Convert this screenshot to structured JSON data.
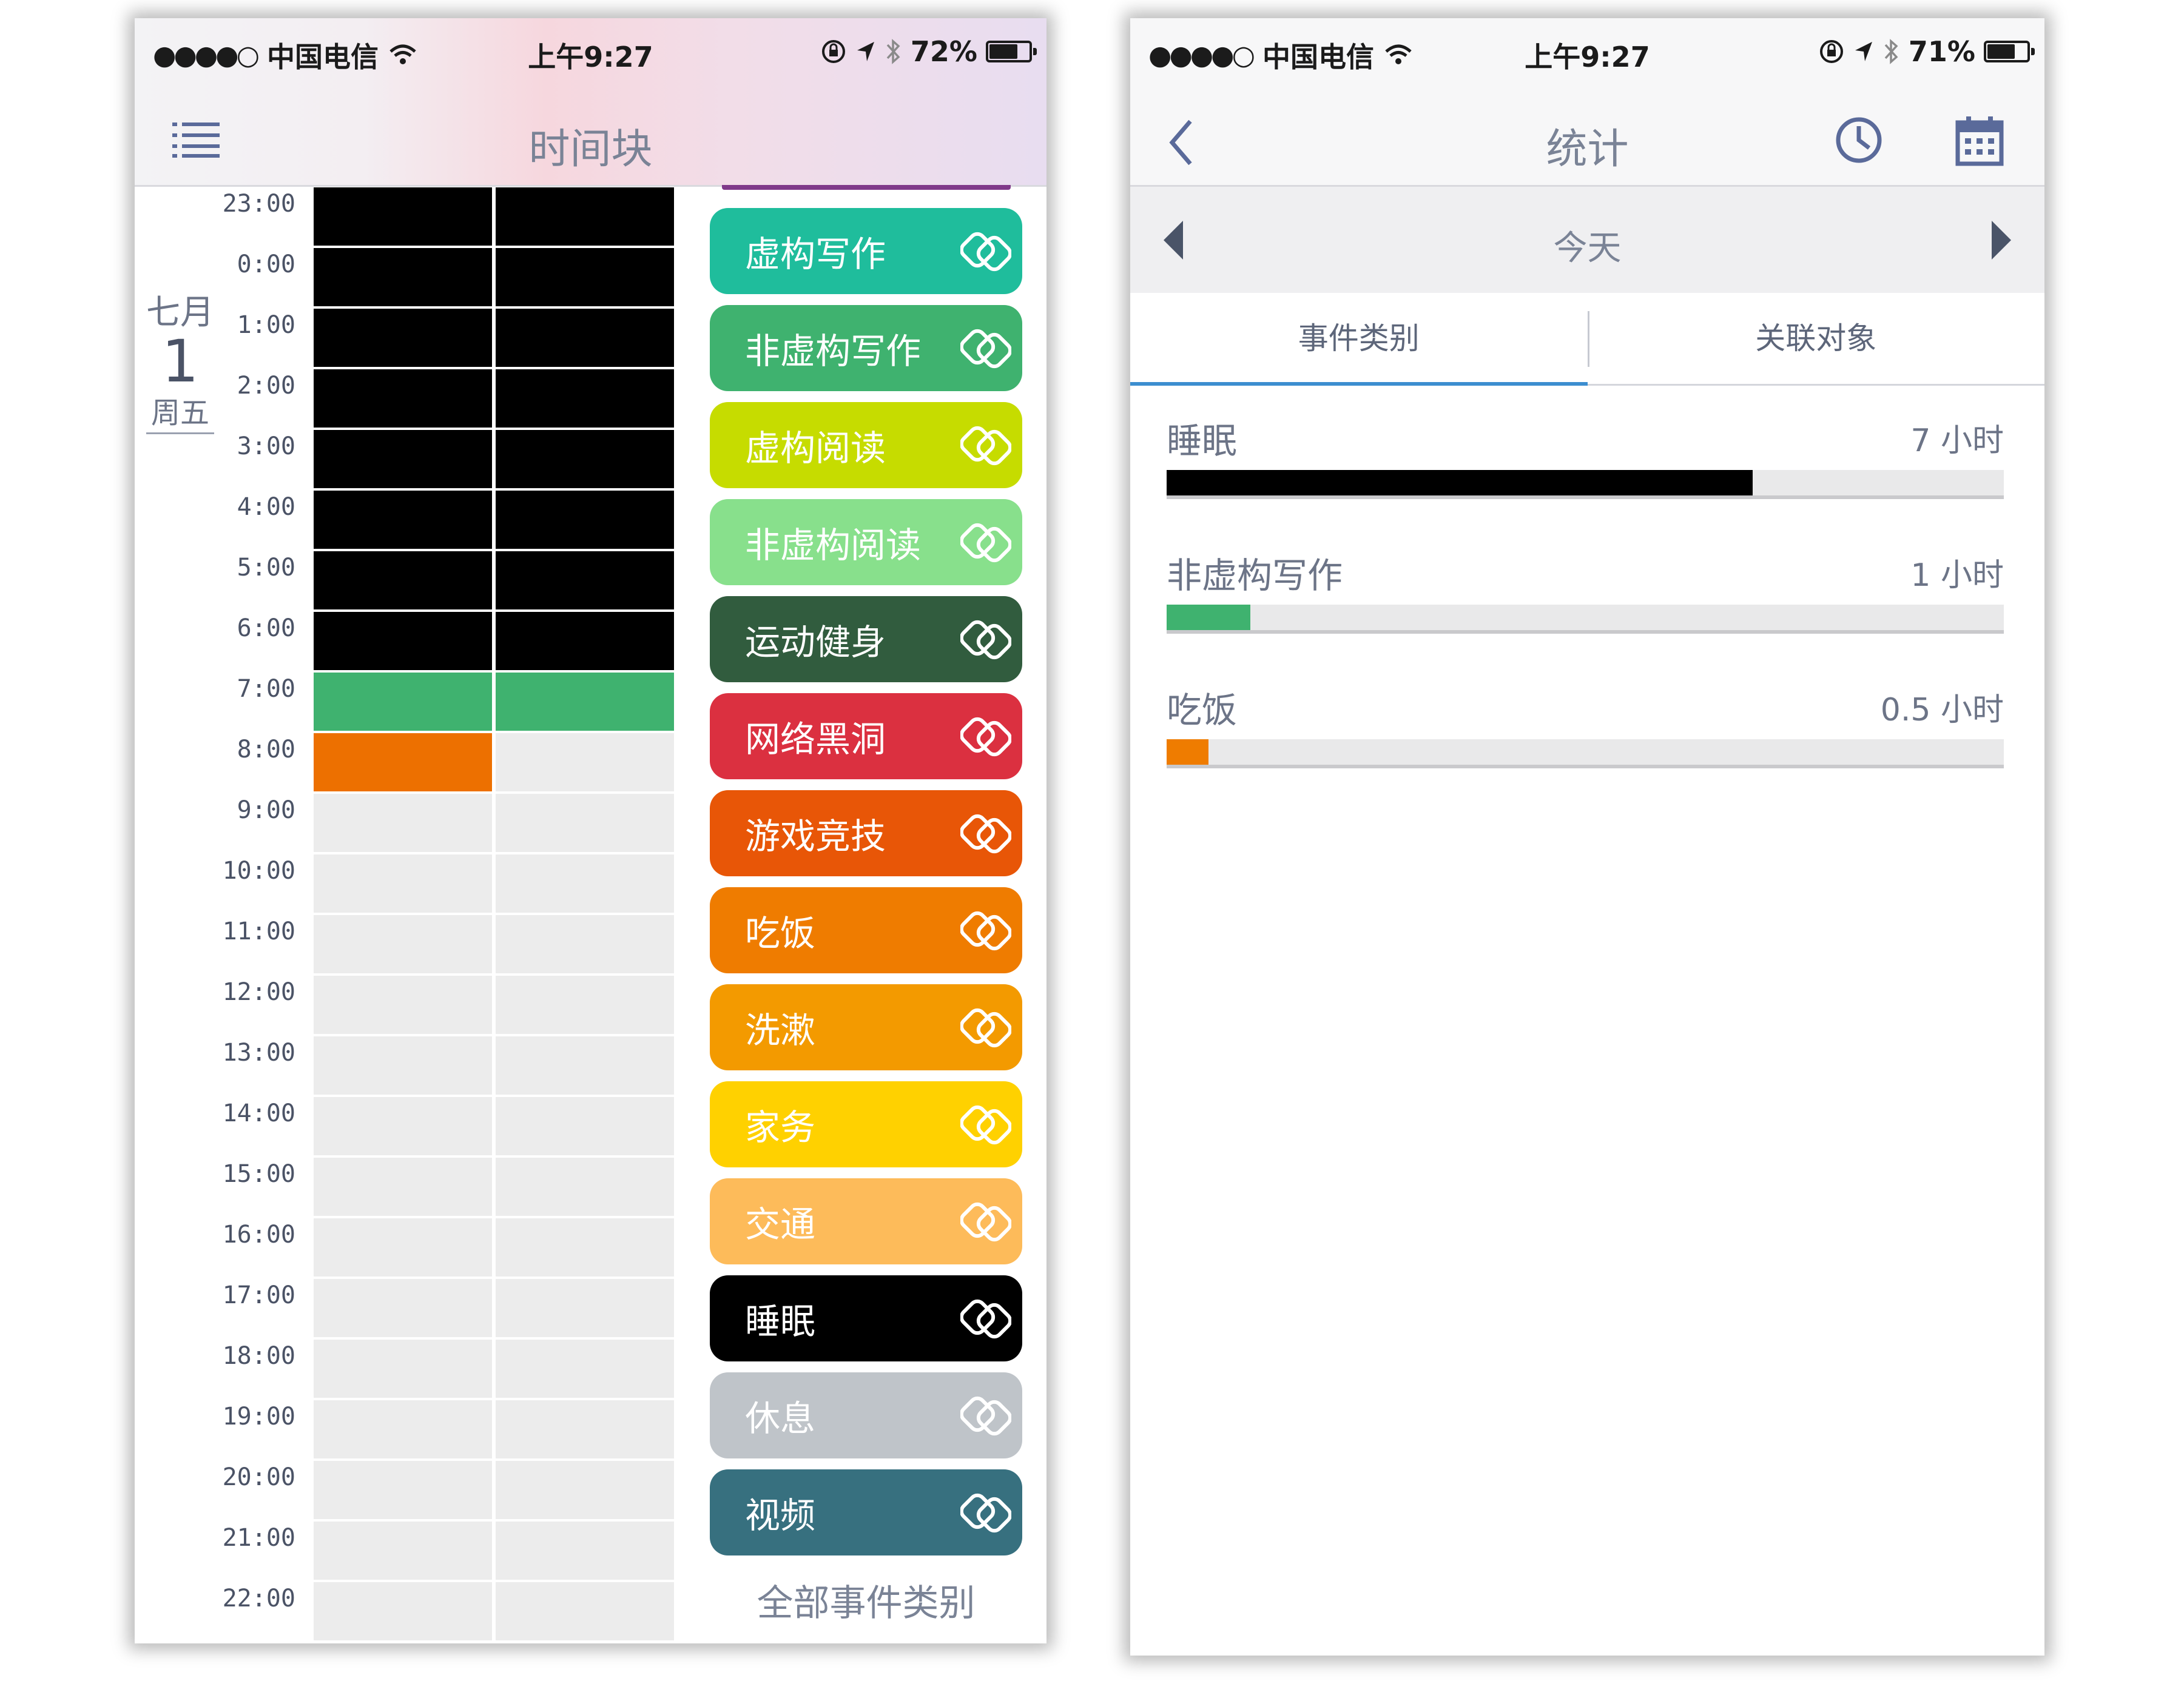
{
  "left_phone": {
    "status": {
      "carrier": "中国电信",
      "time": "上午9:27",
      "battery_text": "72%",
      "battery_level": 0.72
    },
    "nav": {
      "title": "时间块"
    },
    "date": {
      "month": "七月",
      "day": "1",
      "weekday": "周五"
    },
    "hours": [
      "23:00",
      "0:00",
      "1:00",
      "2:00",
      "3:00",
      "4:00",
      "5:00",
      "6:00",
      "7:00",
      "8:00",
      "9:00",
      "10:00",
      "11:00",
      "12:00",
      "13:00",
      "14:00",
      "15:00",
      "16:00",
      "17:00",
      "18:00",
      "19:00",
      "20:00",
      "21:00",
      "22:00"
    ],
    "grid": {
      "empty_color": "#ececec",
      "col1": [
        "#000000",
        "#000000",
        "#000000",
        "#000000",
        "#000000",
        "#000000",
        "#000000",
        "#000000",
        "#3fb26f",
        "#ed7000",
        "",
        "",
        "",
        "",
        "",
        "",
        "",
        "",
        "",
        "",
        "",
        "",
        "",
        ""
      ],
      "col2": [
        "#000000",
        "#000000",
        "#000000",
        "#000000",
        "#000000",
        "#000000",
        "#000000",
        "#000000",
        "#3fb26f",
        "",
        "",
        "",
        "",
        "",
        "",
        "",
        "",
        "",
        "",
        "",
        "",
        "",
        "",
        ""
      ]
    },
    "categories": [
      {
        "label": "虚构写作",
        "color": "#1fbd9c",
        "text_color": "#ffffff"
      },
      {
        "label": "非虚构写作",
        "color": "#3fb26f",
        "text_color": "#ffffff"
      },
      {
        "label": "虚构阅读",
        "color": "#c6dc00",
        "text_color": "#ffffff"
      },
      {
        "label": "非虚构阅读",
        "color": "#88e08c",
        "text_color": "#ffffff"
      },
      {
        "label": "运动健身",
        "color": "#315c3e",
        "text_color": "#ffffff"
      },
      {
        "label": "网络黑洞",
        "color": "#db3040",
        "text_color": "#ffffff"
      },
      {
        "label": "游戏竞技",
        "color": "#e85607",
        "text_color": "#ffffff"
      },
      {
        "label": "吃饭",
        "color": "#ef7c00",
        "text_color": "#ffffff"
      },
      {
        "label": "洗漱",
        "color": "#f39a00",
        "text_color": "#ffffff"
      },
      {
        "label": "家务",
        "color": "#ffd100",
        "text_color": "#ffffff"
      },
      {
        "label": "交通",
        "color": "#fdbb5a",
        "text_color": "#ffffff"
      },
      {
        "label": "睡眠",
        "color": "#000000",
        "text_color": "#ffffff"
      },
      {
        "label": "休息",
        "color": "#bfc4c9",
        "text_color": "#ffffff"
      },
      {
        "label": "视频",
        "color": "#37707f",
        "text_color": "#ffffff"
      }
    ],
    "all_categories_label": "全部事件类别"
  },
  "right_phone": {
    "status": {
      "carrier": "中国电信",
      "time": "上午9:27",
      "battery_text": "71%",
      "battery_level": 0.71
    },
    "nav": {
      "title": "统计"
    },
    "date_bar": {
      "label": "今天"
    },
    "tabs": [
      {
        "label": "事件类别",
        "active": true
      },
      {
        "label": "关联对象",
        "active": false
      }
    ],
    "stats": [
      {
        "label": "睡眠",
        "value": "7 小时",
        "fraction": 0.7,
        "color": "#000000"
      },
      {
        "label": "非虚构写作",
        "value": "1 小时",
        "fraction": 0.1,
        "color": "#3fb26f"
      },
      {
        "label": "吃饭",
        "value": "0.5 小时",
        "fraction": 0.05,
        "color": "#ef7c00"
      }
    ]
  },
  "icons": {
    "menu": "menu-icon",
    "back": "back-chevron-icon",
    "clock": "clock-icon",
    "calendar": "calendar-icon",
    "link": "link-rings-icon",
    "wifi": "wifi-icon",
    "orientation_lock": "orientation-lock-icon",
    "location": "location-arrow-icon",
    "bluetooth": "bluetooth-icon",
    "battery": "battery-icon"
  }
}
